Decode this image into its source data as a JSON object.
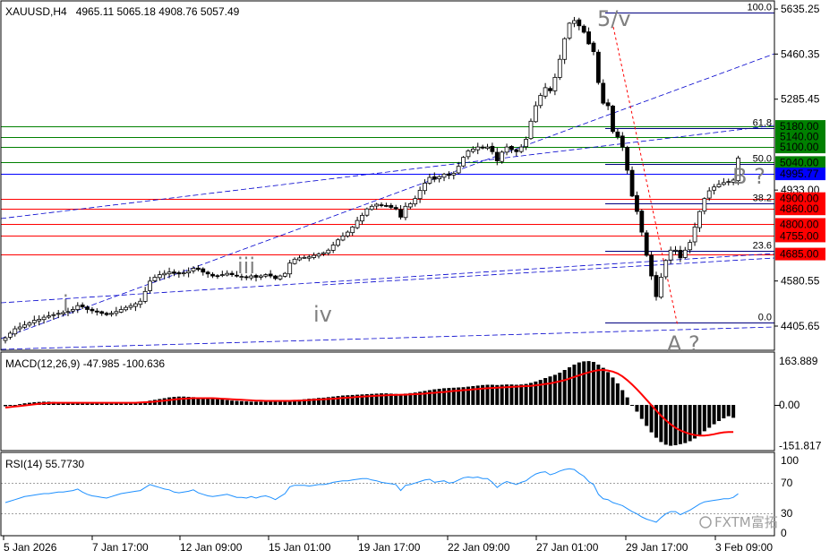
{
  "main": {
    "symbol_timeframe": "XAUUSD,H4",
    "ohlc": "4965.11 5065.18 4908.76 5057.49"
  },
  "macd": {
    "label": "MACD(12,26,9) -47.985 -100.636"
  },
  "rsi": {
    "label": "RSI(14) 55.7730"
  },
  "wave_labels": [
    "i",
    "iii",
    "iv",
    "5/v",
    "A ?",
    "B ?"
  ],
  "watermark": "FXTM富拓",
  "fib_levels": [
    {
      "label": "100.0",
      "value": 5620
    },
    {
      "label": "61.8",
      "value": 5175
    },
    {
      "label": "50.0",
      "value": 5035
    },
    {
      "label": "38.2",
      "value": 4880
    },
    {
      "label": "23.6",
      "value": 4698
    },
    {
      "label": "0.0",
      "value": 4420
    }
  ],
  "price_axis_labels": [
    "5635.25",
    "5460.35",
    "5285.45",
    "4933.00",
    "4580.55",
    "4405.65"
  ],
  "level_tags": [
    {
      "text": "5180.00",
      "color": "#008000",
      "value": 5180
    },
    {
      "text": "5140.00",
      "color": "#008000",
      "value": 5140
    },
    {
      "text": "5100.00",
      "color": "#008000",
      "value": 5100
    },
    {
      "text": "5040.00",
      "color": "#008000",
      "value": 5040
    },
    {
      "text": "4995.77",
      "color": "#0000ff",
      "value": 4995.77
    },
    {
      "text": "4900.00",
      "color": "#ff0000",
      "value": 4900
    },
    {
      "text": "4860.00",
      "color": "#ff0000",
      "value": 4860
    },
    {
      "text": "4800.00",
      "color": "#ff0000",
      "value": 4800
    },
    {
      "text": "4755.00",
      "color": "#ff0000",
      "value": 4755
    },
    {
      "text": "4685.00",
      "color": "#ff0000",
      "value": 4685
    }
  ],
  "macd_axis_labels": [
    "163.889",
    "0.00",
    "-151.817"
  ],
  "rsi_axis_labels": [
    "100",
    "70",
    "30",
    "0"
  ],
  "time_labels": [
    "5 Jan 2026",
    "7 Jan 17:00",
    "12 Jan 09:00",
    "15 Jan 01:00",
    "19 Jan 17:00",
    "22 Jan 09:00",
    "27 Jan 01:00",
    "29 Jan 17:00",
    "3 Feb 09:00"
  ],
  "colors": {
    "bull": "#ffffff",
    "bear": "#000000",
    "macd_signal": "#ff0000",
    "rsi_line": "#1e90ff",
    "trend_lines": "#0000cd",
    "fib": "#000080"
  },
  "chart_data": {
    "type": "candlestick",
    "x": [
      "5 Jan 2026",
      "7 Jan 17:00",
      "12 Jan 09:00",
      "15 Jan 01:00",
      "19 Jan 17:00",
      "22 Jan 09:00",
      "27 Jan 01:00",
      "29 Jan 17:00",
      "3 Feb 09:00"
    ],
    "ohlc_close": [
      4360,
      4378,
      4395,
      4402,
      4410,
      4418,
      4428,
      4432,
      4440,
      4445,
      4450,
      4455,
      4458,
      4462,
      4470,
      4485,
      4480,
      4470,
      4465,
      4460,
      4455,
      4450,
      4455,
      4462,
      4470,
      4478,
      4485,
      4492,
      4502,
      4540,
      4580,
      4595,
      4605,
      4610,
      4615,
      4610,
      4608,
      4612,
      4618,
      4630,
      4625,
      4615,
      4608,
      4600,
      4600,
      4605,
      4610,
      4605,
      4600,
      4598,
      4595,
      4600,
      4595,
      4600,
      4605,
      4600,
      4590,
      4600,
      4610,
      4650,
      4665,
      4670,
      4672,
      4674,
      4680,
      4685,
      4690,
      4700,
      4720,
      4740,
      4755,
      4770,
      4790,
      4815,
      4835,
      4860,
      4870,
      4878,
      4876,
      4872,
      4866,
      4860,
      4828,
      4870,
      4880,
      4900,
      4932,
      4960,
      4982,
      4975,
      4985,
      4995,
      4990,
      4998,
      5025,
      5060,
      5085,
      5092,
      5100,
      5096,
      5100,
      5082,
      5046,
      5080,
      5100,
      5090,
      5082,
      5100,
      5130,
      5200,
      5260,
      5300,
      5330,
      5318,
      5370,
      5440,
      5520,
      5580,
      5590,
      5570,
      5545,
      5500,
      5470,
      5350,
      5270,
      5260,
      5160,
      5140,
      5100,
      5010,
      4910,
      4850,
      4770,
      4680,
      4600,
      4520,
      4595,
      4660,
      4700,
      4700,
      4670,
      4700,
      4730,
      4790,
      4850,
      4900,
      4930,
      4945,
      4955,
      4962,
      4966,
      4972,
      5057.49
    ],
    "macd": [
      -5,
      -3,
      0,
      3,
      6,
      8,
      10,
      11,
      12,
      12,
      11,
      10,
      9,
      8,
      8,
      9,
      10,
      10,
      9,
      8,
      7,
      6,
      6,
      6,
      7,
      8,
      9,
      10,
      11,
      13,
      16,
      19,
      22,
      25,
      28,
      30,
      31,
      31,
      30,
      29,
      28,
      27,
      26,
      24,
      22,
      20,
      18,
      16,
      15,
      14,
      13,
      12,
      12,
      12,
      12,
      12,
      12,
      12,
      13,
      15,
      17,
      19,
      21,
      23,
      24,
      26,
      27,
      29,
      31,
      33,
      35,
      36,
      37,
      38,
      39,
      40,
      41,
      42,
      43,
      43,
      42,
      41,
      40,
      42,
      44,
      46,
      49,
      52,
      55,
      58,
      60,
      62,
      63,
      64,
      65,
      66,
      68,
      70,
      72,
      74,
      75,
      75,
      74,
      75,
      76,
      76,
      75,
      76,
      78,
      82,
      87,
      93,
      100,
      106,
      112,
      120,
      130,
      140,
      150,
      158,
      162,
      163,
      160,
      150,
      138,
      122,
      102,
      80,
      55,
      28,
      0,
      -25,
      -52,
      -78,
      -102,
      -122,
      -138,
      -148,
      -152,
      -150,
      -146,
      -142,
      -135,
      -125,
      -112,
      -98,
      -85,
      -72,
      -60,
      -50,
      -42,
      -47.985
    ],
    "macd_signal": [
      -10,
      -8,
      -6,
      -4,
      -2,
      0,
      2,
      4,
      6,
      7,
      8,
      8,
      8,
      8,
      8,
      8,
      8,
      8,
      8,
      8,
      8,
      8,
      8,
      8,
      8,
      8,
      8,
      8,
      9,
      10,
      11,
      12,
      14,
      16,
      18,
      20,
      22,
      23,
      24,
      25,
      25,
      25,
      25,
      25,
      24,
      23,
      22,
      21,
      20,
      19,
      18,
      17,
      16,
      16,
      15,
      15,
      15,
      15,
      15,
      15,
      16,
      16,
      17,
      18,
      19,
      20,
      21,
      22,
      23,
      24,
      26,
      27,
      28,
      30,
      31,
      32,
      33,
      34,
      35,
      36,
      37,
      37,
      38,
      38,
      39,
      40,
      41,
      42,
      44,
      45,
      47,
      48,
      50,
      52,
      53,
      55,
      56,
      58,
      59,
      61,
      62,
      63,
      64,
      65,
      66,
      67,
      68,
      69,
      70,
      71,
      73,
      75,
      78,
      80,
      84,
      88,
      92,
      98,
      104,
      110,
      116,
      121,
      126,
      129,
      130,
      128,
      124,
      117,
      106,
      92,
      76,
      58,
      39,
      19,
      -1,
      -21,
      -40,
      -57,
      -72,
      -85,
      -95,
      -102,
      -108,
      -112,
      -114,
      -114,
      -112,
      -109,
      -105,
      -102,
      -101,
      -100.636
    ],
    "rsi": [
      44,
      46,
      48,
      50,
      52,
      53,
      54,
      55,
      56,
      56,
      57,
      58,
      58,
      59,
      60,
      62,
      58,
      55,
      53,
      52,
      51,
      50,
      52,
      54,
      56,
      57,
      58,
      59,
      60,
      64,
      68,
      66,
      64,
      62,
      61,
      58,
      57,
      58,
      59,
      61,
      57,
      55,
      53,
      52,
      53,
      54,
      55,
      53,
      51,
      51,
      50,
      52,
      50,
      52,
      53,
      51,
      48,
      52,
      56,
      65,
      67,
      67,
      67,
      66,
      67,
      68,
      68,
      69,
      71,
      72,
      73,
      73,
      74,
      75,
      76,
      76,
      74,
      73,
      71,
      70,
      69,
      68,
      60,
      67,
      68,
      70,
      72,
      74,
      75,
      71,
      72,
      73,
      70,
      71,
      74,
      77,
      78,
      77,
      78,
      76,
      76,
      71,
      64,
      69,
      72,
      70,
      68,
      71,
      73,
      78,
      82,
      84,
      85,
      81,
      83,
      86,
      88,
      89,
      88,
      83,
      79,
      72,
      68,
      55,
      49,
      48,
      44,
      42,
      40,
      36,
      32,
      29,
      25,
      22,
      20,
      18,
      24,
      29,
      32,
      32,
      28,
      31,
      34,
      38,
      42,
      45,
      46,
      47,
      48,
      49,
      49,
      51,
      55.773
    ],
    "ylim_price": [
      4360,
      5660
    ],
    "ylim_macd": [
      -180,
      180
    ],
    "ylim_rsi": [
      0,
      100
    ]
  }
}
